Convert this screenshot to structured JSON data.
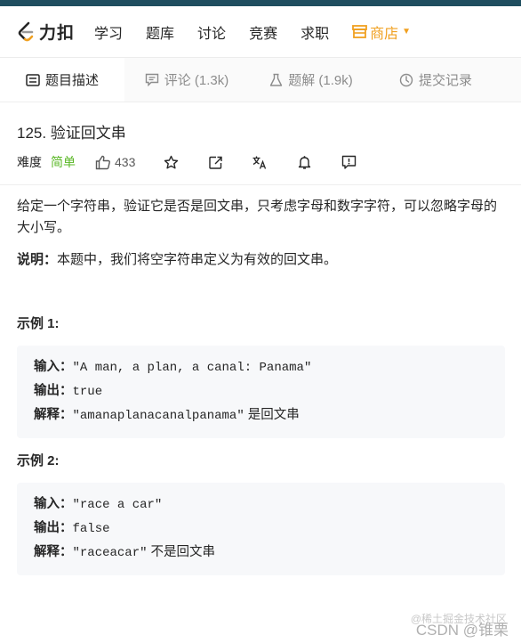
{
  "brand": {
    "name": "力扣"
  },
  "nav": {
    "items": [
      "学习",
      "题库",
      "讨论",
      "竞赛",
      "求职"
    ],
    "store": "商店"
  },
  "tabs": [
    {
      "label": "题目描述",
      "icon": "description-icon"
    },
    {
      "label": "评论 (1.3k)",
      "icon": "comment-icon"
    },
    {
      "label": "题解 (1.9k)",
      "icon": "flask-icon"
    },
    {
      "label": "提交记录",
      "icon": "history-icon"
    }
  ],
  "problem": {
    "title": "125. 验证回文串",
    "difficulty_label": "难度",
    "difficulty": "简单",
    "likes": "433",
    "description": "给定一个字符串，验证它是否是回文串，只考虑字母和数字字符，可以忽略字母的大小写。",
    "note_label": "说明：",
    "note_text": "本题中，我们将空字符串定义为有效的回文串。"
  },
  "examples": [
    {
      "title": "示例 1:",
      "input_label": "输入：",
      "input": "\"A man, a plan, a canal: Panama\"",
      "output_label": "输出：",
      "output": "true",
      "explain_label": "解释：",
      "explain_code": "\"amanaplanacanalpanama\"",
      "explain_text": " 是回文串"
    },
    {
      "title": "示例 2:",
      "input_label": "输入：",
      "input": "\"race a car\"",
      "output_label": "输出：",
      "output": "false",
      "explain_label": "解释：",
      "explain_code": "\"raceacar\"",
      "explain_text": " 不是回文串"
    }
  ],
  "watermark": {
    "line1": "@稀土掘金技术社区",
    "line2": "CSDN @锥栗"
  },
  "colors": {
    "topbar": "#1f4e5f",
    "easy": "#5ab726",
    "store": "#f0a020"
  }
}
